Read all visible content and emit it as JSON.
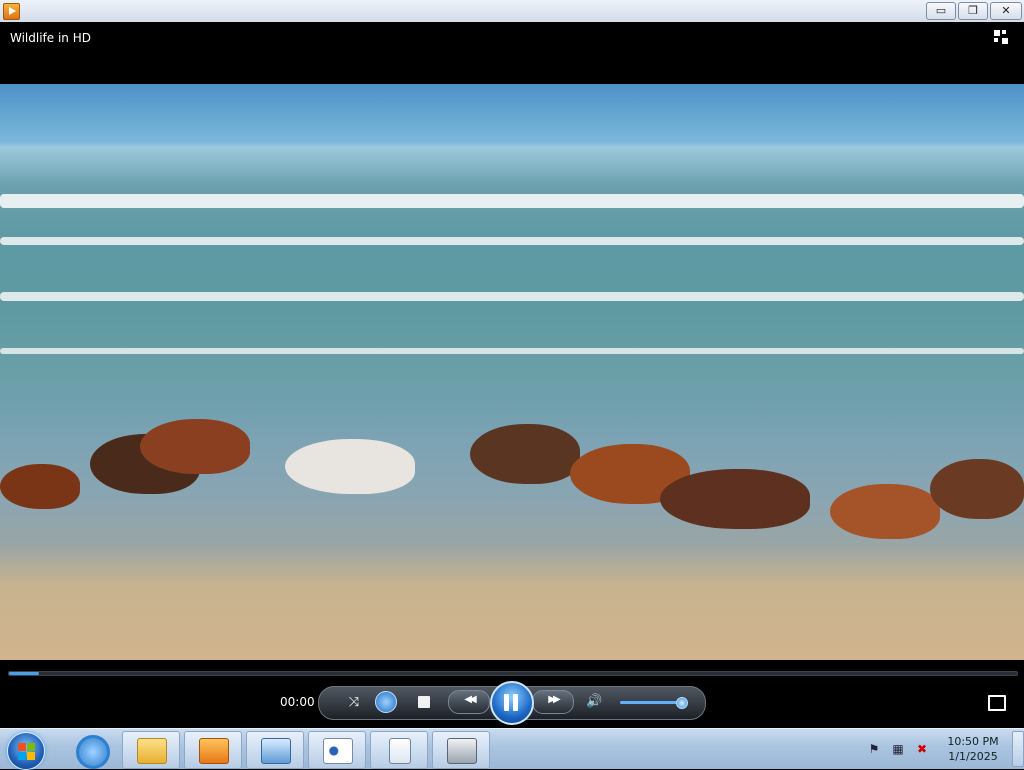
{
  "window": {
    "minimize_glyph": "▭",
    "maximize_glyph": "❐",
    "close_glyph": "✕"
  },
  "player": {
    "title": "Wildlife in HD",
    "elapsed_time": "00:00",
    "progress_fraction": 0.03,
    "volume_fraction": 0.95,
    "state": "playing"
  },
  "icons": {
    "app": "windows-media-player-icon",
    "switch_library": "switch-to-library-icon",
    "shuffle": "shuffle-icon",
    "repeat": "repeat-icon",
    "stop": "stop-icon",
    "previous": "previous-icon",
    "pause": "pause-icon",
    "next": "next-icon",
    "volume": "speaker-icon",
    "fullscreen": "fullscreen-icon"
  },
  "controls_glyphs": {
    "shuffle": "⤨",
    "previous": "◀◀",
    "next": "▶▶",
    "volume": "🔊"
  },
  "taskbar": {
    "pinned": [
      {
        "name": "internet-explorer-icon"
      },
      {
        "name": "file-explorer-icon"
      },
      {
        "name": "windows-media-player-icon"
      },
      {
        "name": "control-panel-icon"
      },
      {
        "name": "eyes-app-icon"
      },
      {
        "name": "document-icon"
      },
      {
        "name": "printer-icon"
      }
    ],
    "clock_time": "10:50 PM",
    "clock_date": "1/1/2025",
    "tray_icons": [
      "action-center-flag-icon",
      "network-icon",
      "volume-muted-icon"
    ]
  },
  "colors": {
    "accent": "#1c68c6",
    "seek_fill": "#4aa0e8"
  }
}
